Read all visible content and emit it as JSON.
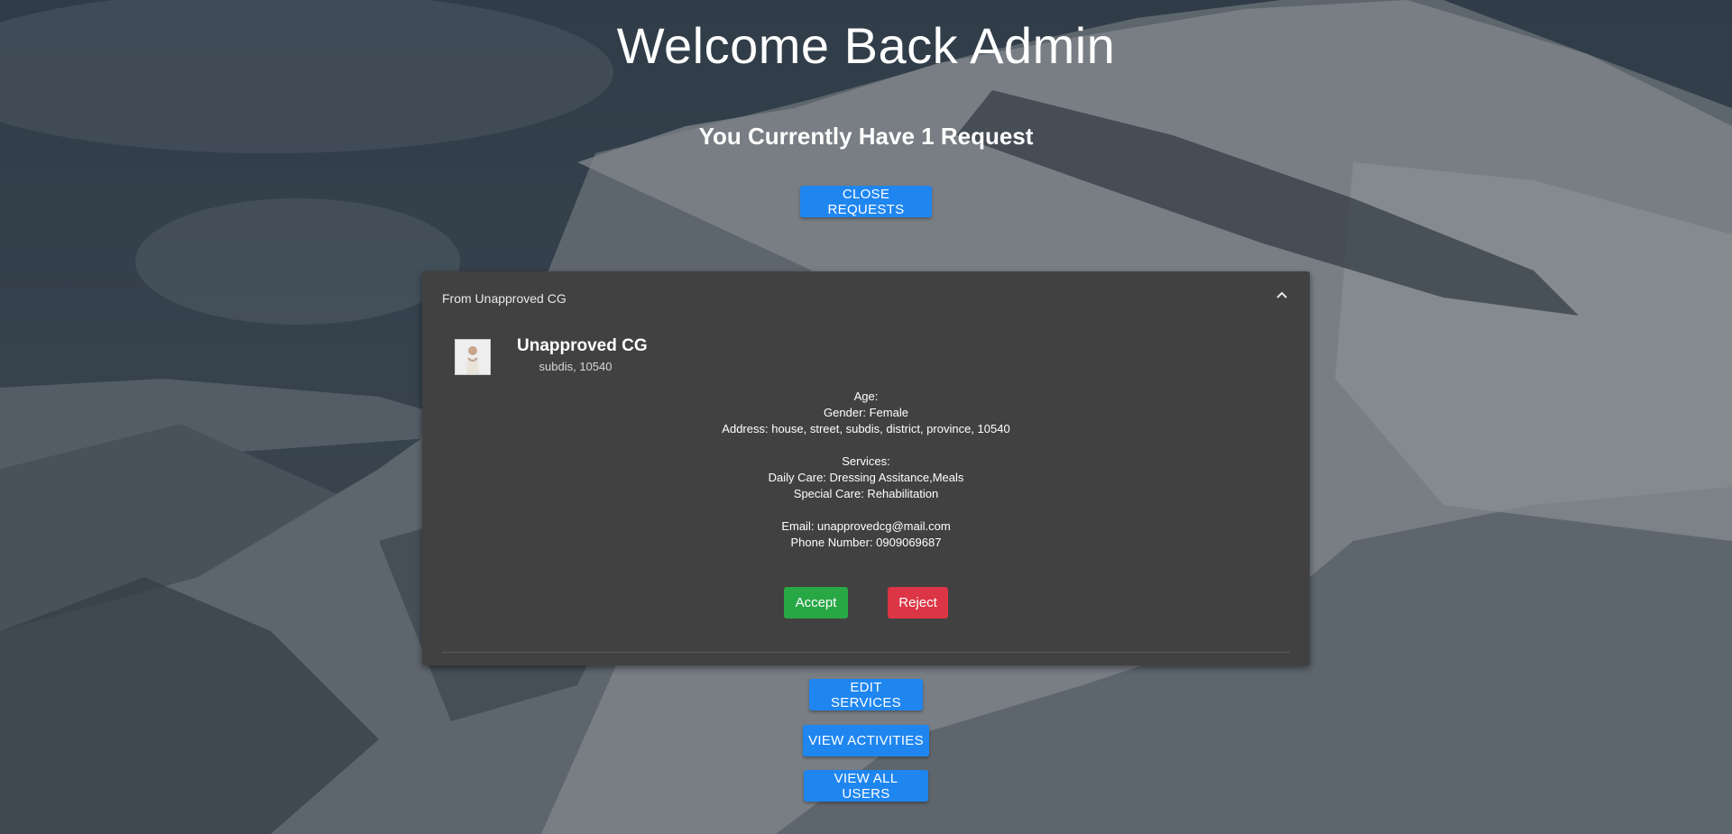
{
  "header": {
    "title": "Welcome Back Admin",
    "subtitle": "You Currently Have 1 Request",
    "close_requests_label": "CLOSE REQUESTS"
  },
  "request": {
    "header": "From Unapproved CG",
    "name": "Unapproved CG",
    "location": "subdis, 10540",
    "age": "Age:",
    "gender": "Gender: Female",
    "address": "Address: house, street, subdis, district, province, 10540",
    "services_heading": "Services:",
    "daily_care": "Daily Care: Dressing Assitance,Meals",
    "special_care": "Special Care: Rehabilitation",
    "email": "Email: unapprovedcg@mail.com",
    "phone": "Phone Number: 0909069687",
    "accept_label": "Accept",
    "reject_label": "Reject"
  },
  "actions": {
    "edit_services_label": "EDIT SERVICES",
    "view_activities_label": "VIEW ACTIVITIES",
    "view_all_users_label": "VIEW ALL USERS"
  },
  "colors": {
    "primary": "#1f86f0",
    "success": "#28a745",
    "danger": "#dc3545",
    "panel": "#414141"
  },
  "icons": {
    "collapse": "chevron-up-icon",
    "avatar": "user-avatar"
  }
}
